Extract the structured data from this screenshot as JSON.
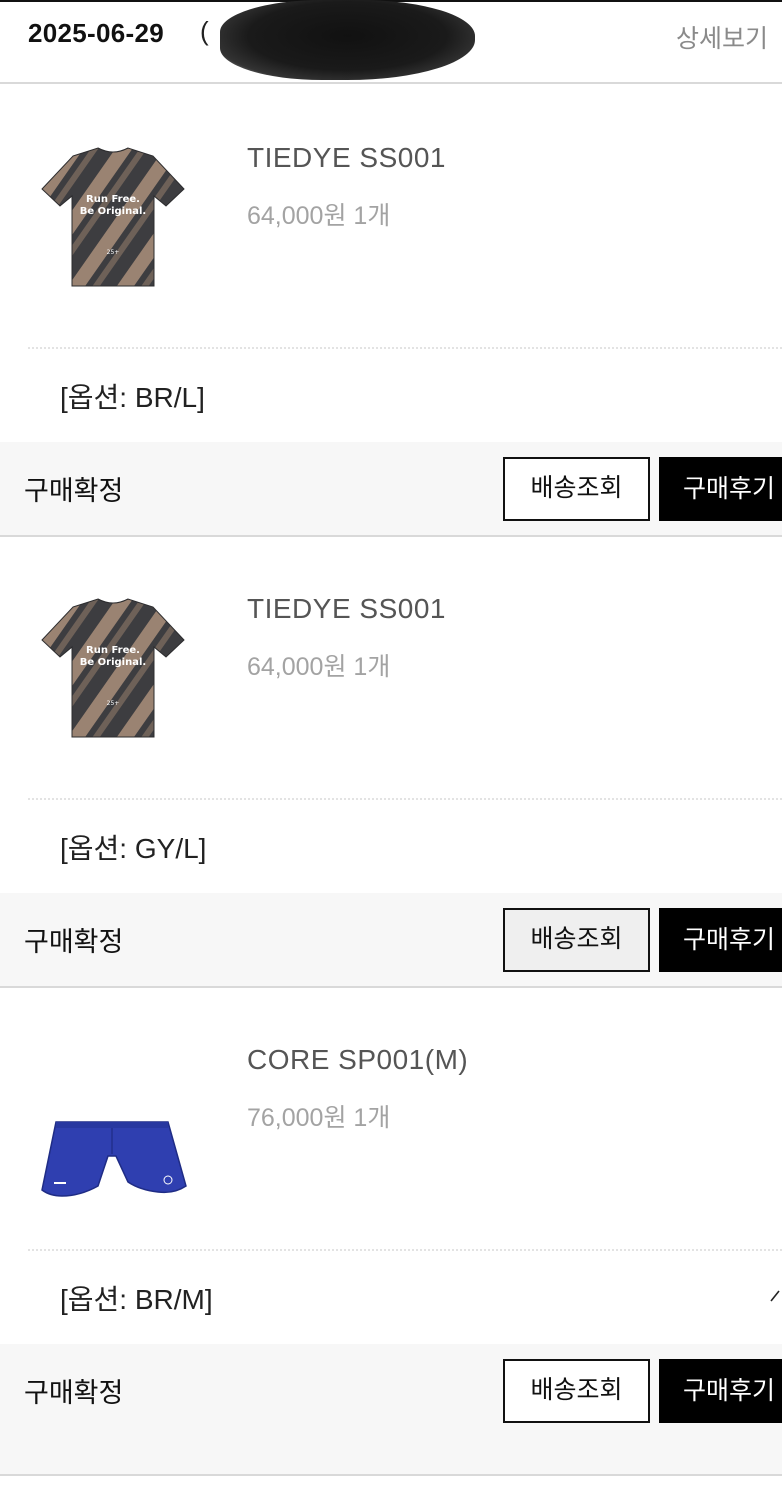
{
  "header": {
    "order_date": "2025-06-29",
    "order_number_visible": "(",
    "detail_label": "상세보기"
  },
  "items": [
    {
      "product_name": "TIEDYE SS001",
      "price_qty": "64,000원 1개",
      "option": "[옵션: BR/L]",
      "status": "구매확정",
      "tracking_label": "배송조회",
      "review_label": "구매후기",
      "thumb": "tiedye-tshirt",
      "shirt_text_line1": "Run Free.",
      "shirt_text_line2": "Be Original.",
      "shirt_small_text": "25+"
    },
    {
      "product_name": "TIEDYE SS001",
      "price_qty": "64,000원 1개",
      "option": "[옵션: GY/L]",
      "status": "구매확정",
      "tracking_label": "배송조회",
      "review_label": "구매후기",
      "thumb": "tiedye-tshirt",
      "shirt_text_line1": "Run Free.",
      "shirt_text_line2": "Be Original.",
      "shirt_small_text": "25+"
    },
    {
      "product_name": "CORE SP001(M)",
      "price_qty": "76,000원 1개",
      "option": "[옵션: BR/M]",
      "status": "구매확정",
      "tracking_label": "배송조회",
      "review_label": "구매후기",
      "thumb": "blue-running-shorts"
    }
  ],
  "colors": {
    "tshirt_dark": "#3c3c3e",
    "tshirt_tan": "#9a8372",
    "shorts_blue": "#2f3fb0",
    "muted_text": "#a3a3a3",
    "status_bg": "#f7f7f7"
  }
}
